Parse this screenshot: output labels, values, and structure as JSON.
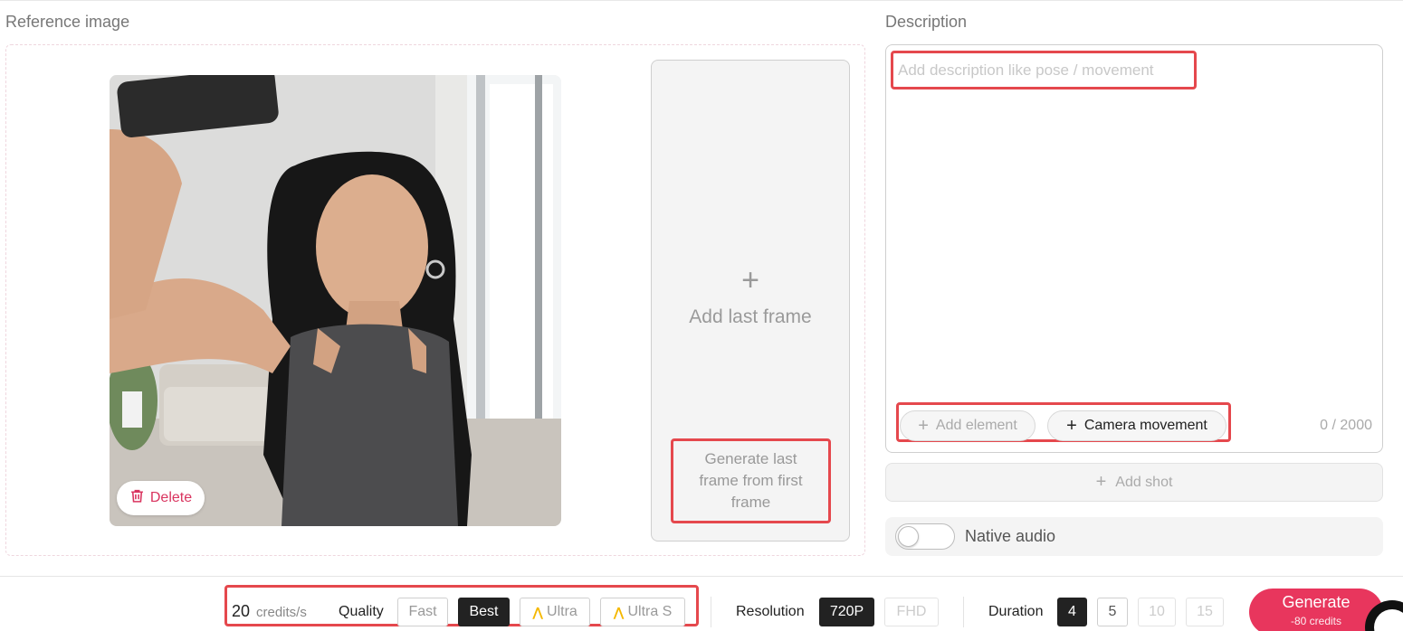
{
  "reference": {
    "label": "Reference image",
    "delete_label": "Delete",
    "add_last_frame_label": "Add last frame",
    "generate_last_frame_label": "Generate last frame from first frame"
  },
  "description": {
    "label": "Description",
    "placeholder": "Add description like pose / movement",
    "value": "",
    "add_element_label": "Add element",
    "camera_movement_label": "Camera movement",
    "char_count": "0 / 2000",
    "add_shot_label": "Add shot",
    "native_audio_label": "Native audio",
    "native_audio_on": false
  },
  "controls": {
    "credits_value": "20",
    "credits_unit": "credits/s",
    "quality_label": "Quality",
    "quality_options": [
      "Fast",
      "Best",
      "Ultra",
      "Ultra S"
    ],
    "quality_selected": "Best",
    "resolution_label": "Resolution",
    "resolution_options": [
      "720P",
      "FHD"
    ],
    "resolution_selected": "720P",
    "duration_label": "Duration",
    "duration_options": [
      "4",
      "5",
      "10",
      "15"
    ],
    "duration_selected": "4",
    "generate_label": "Generate",
    "generate_cost": "-80 credits"
  },
  "colors": {
    "accent": "#e8365d",
    "highlight": "#e5484d",
    "selected": "#222222"
  },
  "icons": {
    "delete": "trash-icon",
    "add": "plus-icon",
    "premium": "crown-icon"
  }
}
